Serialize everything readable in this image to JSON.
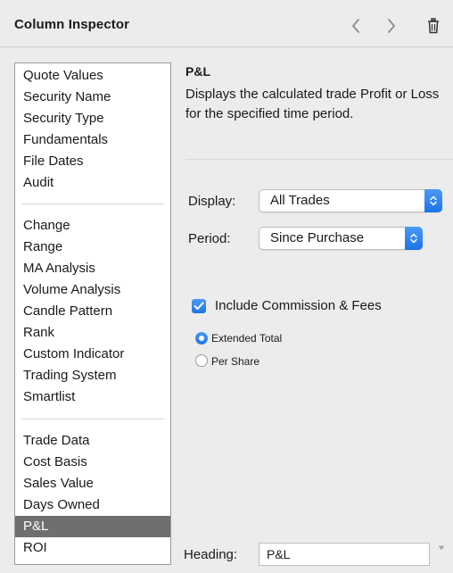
{
  "window": {
    "title": "Column Inspector",
    "icons": [
      "chevron-left-icon",
      "chevron-right-icon",
      "trash-icon"
    ]
  },
  "sidebar": {
    "groups": [
      {
        "items": [
          "Quote Values",
          "Security Name",
          "Security Type",
          "Fundamentals",
          "File Dates",
          "Audit"
        ]
      },
      {
        "items": [
          "Change",
          "Range",
          "MA Analysis",
          "Volume Analysis",
          "Candle Pattern",
          "Rank",
          "Custom Indicator",
          "Trading System",
          "Smartlist"
        ]
      },
      {
        "items": [
          "Trade Data",
          "Cost Basis",
          "Sales Value",
          "Days Owned",
          "P&L",
          "ROI"
        ]
      }
    ],
    "selected": "P&L"
  },
  "detail": {
    "title": "P&L",
    "description": "Displays the calculated trade Profit or Loss for the specified time period.",
    "display": {
      "label": "Display:",
      "value": "All Trades"
    },
    "period": {
      "label": "Period:",
      "value": "Since Purchase"
    },
    "include_commission": {
      "label": "Include Commission & Fees",
      "checked": true
    },
    "radios": [
      {
        "label": "Extended Total",
        "selected": true
      },
      {
        "label": "Per Share",
        "selected": false
      }
    ],
    "heading": {
      "label": "Heading:",
      "value": "P&L"
    }
  },
  "colors": {
    "accent": "#1f74e8",
    "selection": "#6f6f6f"
  }
}
